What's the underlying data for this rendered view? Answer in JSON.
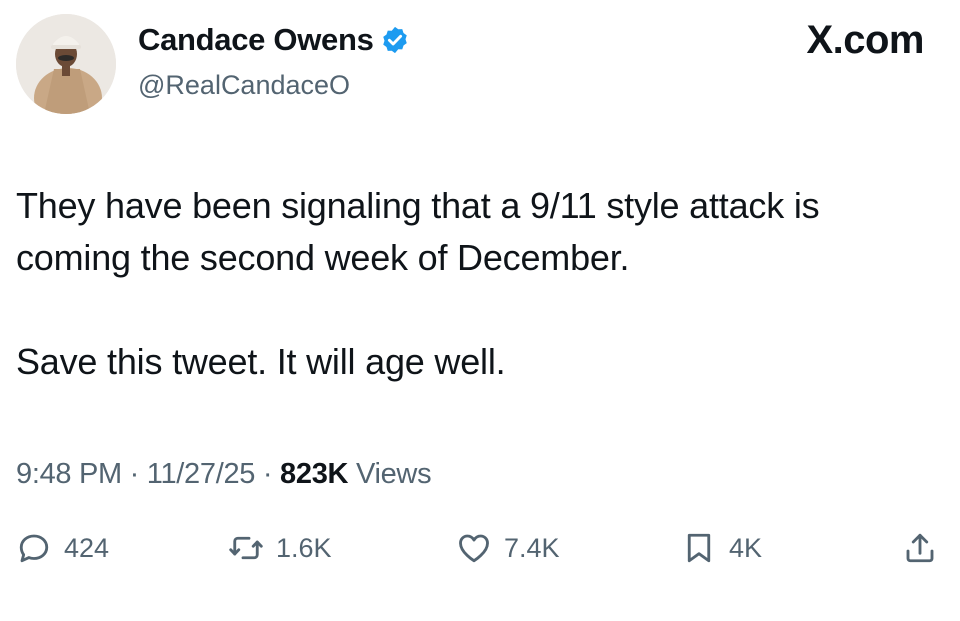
{
  "author": {
    "name": "Candace Owens",
    "handle": "@RealCandaceO",
    "verified": true
  },
  "brand": "X.com",
  "tweet": {
    "lines": [
      "They have been signaling that a 9/11 style attack is",
      "coming the second week of December.",
      "Save this tweet. It will age well."
    ]
  },
  "meta": {
    "time": "9:48 PM",
    "sep1": "·",
    "date": "11/27/25",
    "sep2": "·",
    "views_count": "823K",
    "views_label": "Views"
  },
  "actions": {
    "replies": "424",
    "reposts": "1.6K",
    "likes": "7.4K",
    "bookmarks": "4K"
  },
  "icons": [
    "reply-icon",
    "repost-icon",
    "like-icon",
    "bookmark-icon",
    "share-icon",
    "verified-badge-icon"
  ],
  "colors": {
    "verified": "#1d9bf0",
    "secondary_text": "#536471",
    "primary_text": "#0f1419"
  }
}
